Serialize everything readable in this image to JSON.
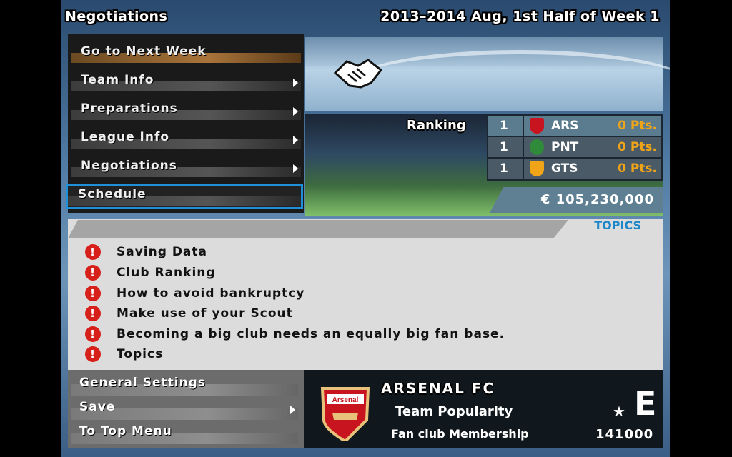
{
  "header": {
    "title": "Negotiations",
    "date": "2013–2014 Aug, 1st Half of Week 1"
  },
  "menu": {
    "items": [
      {
        "label": "Go to Next Week",
        "arrow": false
      },
      {
        "label": "Team Info",
        "arrow": true
      },
      {
        "label": "Preparations",
        "arrow": true
      },
      {
        "label": "League Info",
        "arrow": true
      },
      {
        "label": "Negotiations",
        "arrow": true
      },
      {
        "label": "Schedule",
        "arrow": false
      }
    ],
    "selected": "Schedule"
  },
  "ranking": {
    "label": "Ranking",
    "rows": [
      {
        "pos": "1",
        "team": "ARS",
        "pts": "0 Pts.",
        "crest_color": "#c8141e"
      },
      {
        "pos": "1",
        "team": "PNT",
        "pts": "0 Pts.",
        "crest_color": "#2f8a3a"
      },
      {
        "pos": "1",
        "team": "GTS",
        "pts": "0 Pts.",
        "crest_color": "#f0a418"
      }
    ]
  },
  "funds": "€ 105,230,000",
  "topics": {
    "tag": "TOPICS",
    "items": [
      "Saving Data",
      "Club Ranking",
      "How to avoid bankruptcy",
      "Make use of your Scout",
      "Becoming a big club needs an equally big fan base.",
      "Topics"
    ]
  },
  "bottom_menu": {
    "items": [
      {
        "label": "General Settings",
        "arrow": false
      },
      {
        "label": "Save",
        "arrow": true
      },
      {
        "label": "To Top Menu",
        "arrow": false
      }
    ]
  },
  "club": {
    "name": "ARSENAL FC",
    "popularity_label": "Team Popularity",
    "popularity_star": "★",
    "popularity_grade": "E",
    "fan_label": "Fan club Membership",
    "fan_count": "141000",
    "crest_text": "Arsenal"
  },
  "colors": {
    "accent": "#1f90d8",
    "points": "#f0a418",
    "alert": "#d8201a",
    "topics_tag": "#1d87c9"
  }
}
